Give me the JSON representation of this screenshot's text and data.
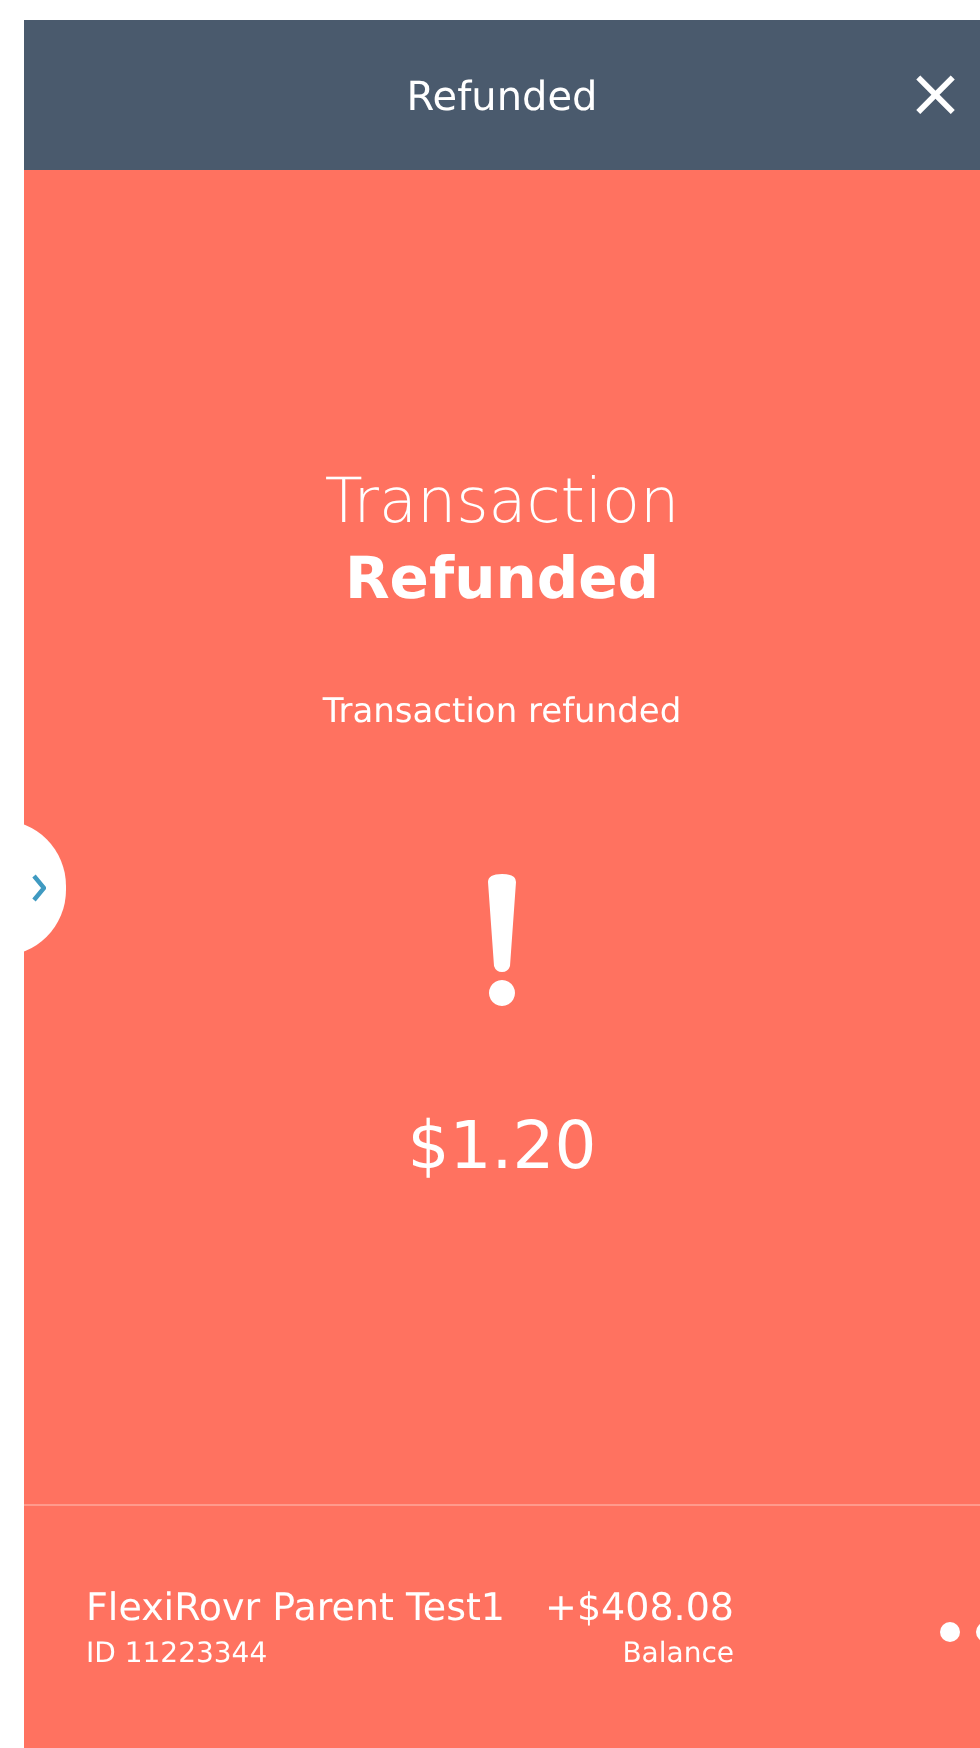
{
  "header": {
    "title": "Refunded",
    "close": "×"
  },
  "result": {
    "title": "Transaction",
    "status": "Refunded",
    "message": "Transaction refunded",
    "amount": "$1.20"
  },
  "account": {
    "name": "FlexiRovr Parent Test1",
    "id": "ID 11223344",
    "balance": "+$408.08",
    "balance_label": "Balance"
  }
}
